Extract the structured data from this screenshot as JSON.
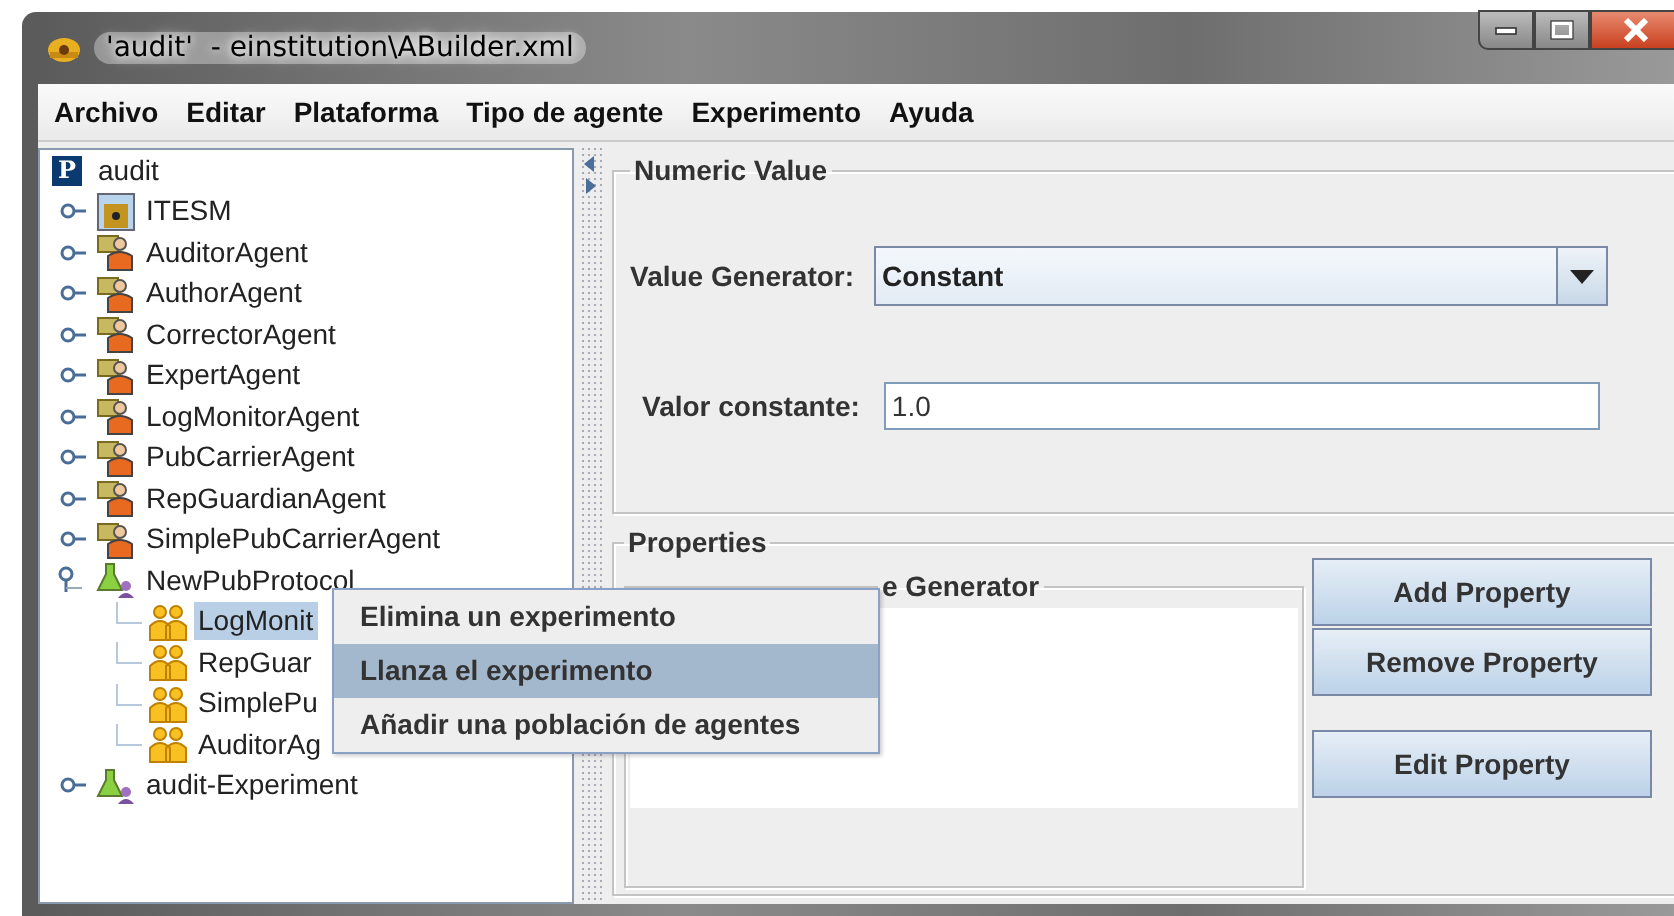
{
  "window": {
    "title": "'audit'  - einstitution\\ABuilder.xml"
  },
  "menu": [
    "Archivo",
    "Editar",
    "Plataforma",
    "Tipo de agente",
    "Experimento",
    "Ayuda"
  ],
  "tree": {
    "label": "audit",
    "kind": "root",
    "badge": "P",
    "selected": false,
    "children": [
      {
        "label": "ITESM",
        "kind": "organization",
        "expanded": false,
        "selected": false
      },
      {
        "label": "AuditorAgent",
        "kind": "agent",
        "expanded": false,
        "selected": false
      },
      {
        "label": "AuthorAgent",
        "kind": "agent",
        "expanded": false,
        "selected": false
      },
      {
        "label": "CorrectorAgent",
        "kind": "agent",
        "expanded": false,
        "selected": false
      },
      {
        "label": "ExpertAgent",
        "kind": "agent",
        "expanded": false,
        "selected": false
      },
      {
        "label": "LogMonitorAgent",
        "kind": "agent",
        "expanded": false,
        "selected": false
      },
      {
        "label": "PubCarrierAgent",
        "kind": "agent",
        "expanded": false,
        "selected": false
      },
      {
        "label": "RepGuardianAgent",
        "kind": "agent",
        "expanded": false,
        "selected": false
      },
      {
        "label": "SimplePubCarrierAgent",
        "kind": "agent",
        "expanded": false,
        "selected": false
      },
      {
        "label": "NewPubProtocol",
        "kind": "protocol",
        "expanded": true,
        "selected": false,
        "children": [
          {
            "label": "LogMonit",
            "kind": "population",
            "selected": true
          },
          {
            "label": "RepGuar",
            "kind": "population",
            "selected": false
          },
          {
            "label": "SimplePu",
            "kind": "population",
            "selected": false
          },
          {
            "label": "AuditorAg",
            "kind": "population",
            "selected": false
          }
        ]
      },
      {
        "label": "audit-Experiment",
        "kind": "protocol",
        "expanded": false,
        "selected": false
      }
    ]
  },
  "numeric_value": {
    "title": "Numeric Value",
    "value_generator": {
      "label": "Value Generator:",
      "value": "Constant"
    },
    "constant": {
      "label": "Valor constante:",
      "value": "1.0"
    }
  },
  "properties": {
    "title": "Properties",
    "generator_group": {
      "title": "e Generator"
    },
    "buttons": [
      "Add Property",
      "Remove Property",
      "Edit Property"
    ]
  },
  "context_menu": [
    {
      "label": "Elimina un experimento",
      "selected": false
    },
    {
      "label": "Llanza el experimento",
      "selected": true
    },
    {
      "label": "Añadir una población de agentes",
      "selected": false
    }
  ]
}
